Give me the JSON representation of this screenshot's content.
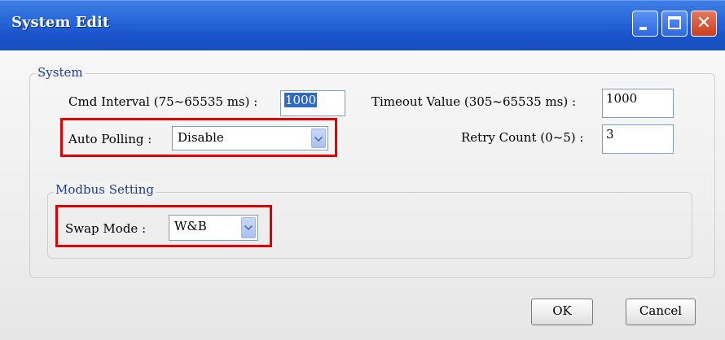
{
  "window": {
    "title": "System Edit"
  },
  "system_group": {
    "label": "System",
    "cmd_interval": {
      "label": "Cmd Interval (75~65535 ms) :",
      "value": "1000"
    },
    "timeout": {
      "label": "Timeout Value (305~65535 ms) :",
      "value": "1000"
    },
    "auto_polling": {
      "label": "Auto Polling :",
      "value": "Disable"
    },
    "retry_count": {
      "label": "Retry Count (0~5) :",
      "value": "3"
    }
  },
  "modbus_group": {
    "label": "Modbus Setting",
    "swap_mode": {
      "label": "Swap Mode :",
      "value": "W&B"
    }
  },
  "buttons": {
    "ok": "OK",
    "cancel": "Cancel"
  },
  "colors": {
    "titlebar": "#2563d8",
    "highlight": "#e00000",
    "group_label": "#1d3c8f",
    "selection": "#316ac5"
  },
  "icons": {
    "minimize": "minimize-icon",
    "maximize": "maximize-icon",
    "close": "close-icon",
    "dropdown": "chevron-down-icon"
  }
}
